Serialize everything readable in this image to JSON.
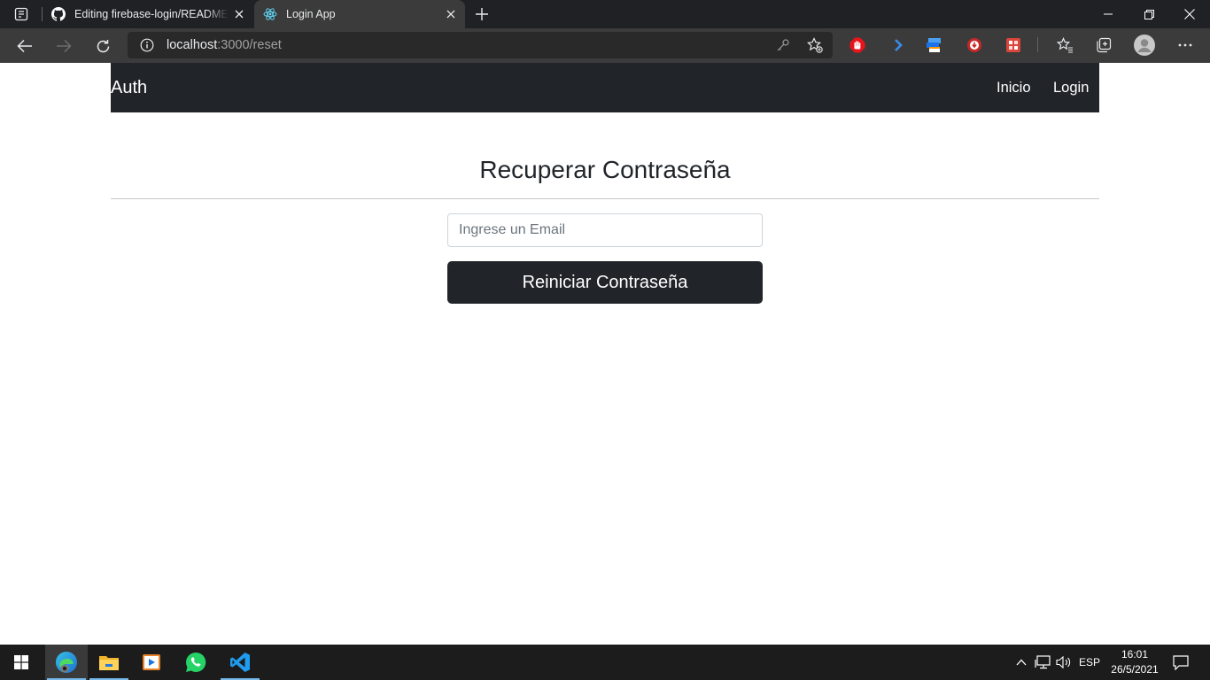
{
  "browser": {
    "tabs": [
      {
        "title": "Editing firebase-login/README.md",
        "icon": "github-icon",
        "active": false
      },
      {
        "title": "Login App",
        "icon": "react-icon",
        "active": true
      }
    ],
    "address": {
      "host": "localhost",
      "path": ":3000/reset"
    },
    "extensions": [
      "hand-stop-extension-icon",
      "arrow-extension-icon",
      "translate-extension-icon",
      "download-extension-icon",
      "puzzle-red-extension-icon"
    ]
  },
  "page": {
    "brand": "Auth",
    "nav_links": [
      "Inicio",
      "Login"
    ],
    "title": "Recuperar Contraseña",
    "email_placeholder": "Ingrese un Email",
    "email_value": "",
    "submit_label": "Reiniciar Contraseña"
  },
  "taskbar": {
    "language": "ESP",
    "time": "16:01",
    "date": "26/5/2021",
    "pinned": [
      "edge-icon",
      "file-explorer-icon",
      "media-player-icon",
      "whatsapp-icon",
      "vscode-icon"
    ]
  },
  "colors": {
    "navbar_bg": "#212529",
    "button_bg": "#212529",
    "browser_frame": "#202124",
    "toolbar": "#3b3b3b"
  }
}
